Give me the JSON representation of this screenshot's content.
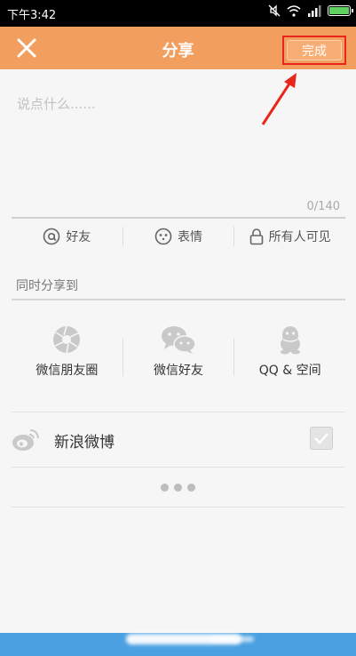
{
  "statusbar": {
    "time": "下午3:42",
    "icons": [
      "mute-icon",
      "wifi-icon",
      "signal-icon",
      "battery-icon"
    ],
    "battery_level": 1.0
  },
  "header": {
    "title": "分享",
    "done_label": "完成",
    "close_icon": "close-icon",
    "accent": "#f29e5f"
  },
  "composer": {
    "placeholder": "说点什么......",
    "counter": "0/140"
  },
  "tools": {
    "friends": "好友",
    "emoji": "表情",
    "visibility": "所有人可见"
  },
  "share": {
    "section_title": "同时分享到",
    "targets": [
      {
        "label": "微信朋友圈",
        "icon": "wechat-moments-icon"
      },
      {
        "label": "微信好友",
        "icon": "wechat-icon"
      },
      {
        "label": "QQ & 空间",
        "icon": "qq-icon"
      }
    ],
    "weibo_label": "新浪微博",
    "weibo_checked": true
  },
  "annotation": {
    "highlight_color": "#e8261b"
  }
}
